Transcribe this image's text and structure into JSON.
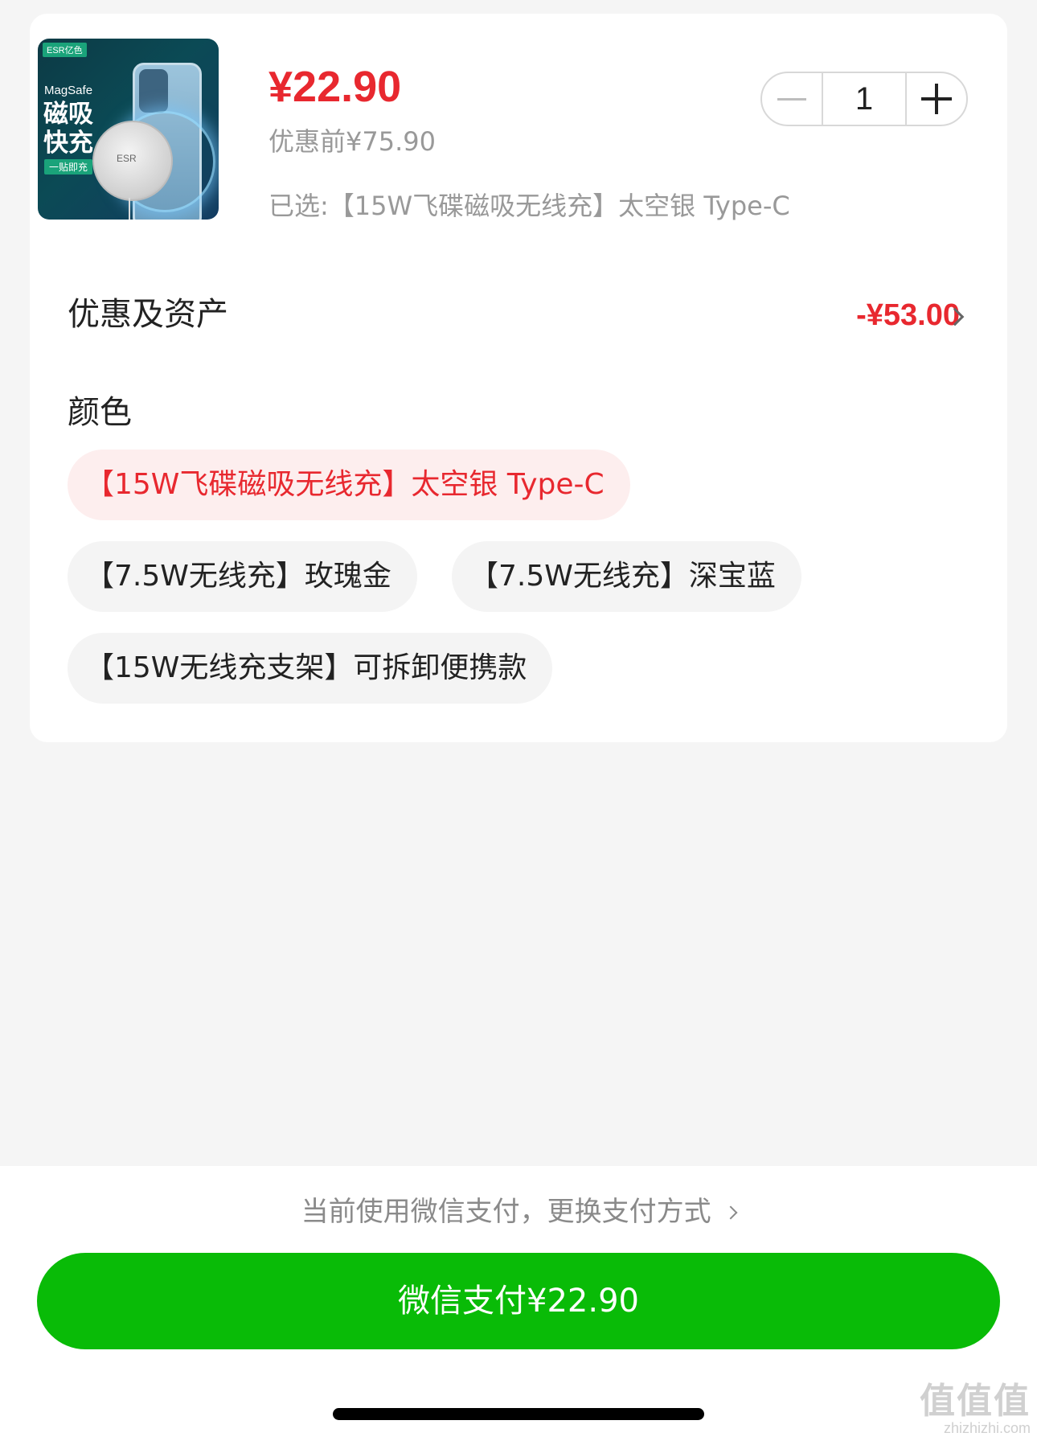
{
  "product": {
    "image_brand": "ESR亿色",
    "image_magsafe": "MagSafe",
    "image_title": "磁吸快充",
    "image_tag": "一贴即充",
    "image_puck_logo": "ESR",
    "price": "¥22.90",
    "original_price": "优惠前¥75.90",
    "selected_option": "已选:【15W飞碟磁吸无线充】太空银 Type-C"
  },
  "quantity": {
    "value": "1",
    "decrement_icon": "minus-icon",
    "increment_icon": "plus-icon"
  },
  "discounts": {
    "label": "优惠及资产",
    "value": "-¥53.00",
    "chevron_icon": "chevron-right-icon"
  },
  "color": {
    "label": "颜色",
    "options": [
      {
        "label": "【15W飞碟磁吸无线充】太空银 Type-C",
        "selected": true
      },
      {
        "label": "【7.5W无线充】玫瑰金",
        "selected": false
      },
      {
        "label": "【7.5W无线充】深宝蓝",
        "selected": false
      },
      {
        "label": "【15W无线充支架】可拆卸便携款",
        "selected": false
      }
    ]
  },
  "payment": {
    "switch_text": "当前使用微信支付，更换支付方式",
    "pay_button": "微信支付¥22.90"
  },
  "watermark": {
    "main": "值值值",
    "site": "zhizhizhi.com"
  },
  "colors": {
    "accent_red": "#e8282f",
    "pay_green": "#09bb07",
    "chip_selected_bg": "#fdeeee",
    "chip_bg": "#f4f4f4"
  }
}
